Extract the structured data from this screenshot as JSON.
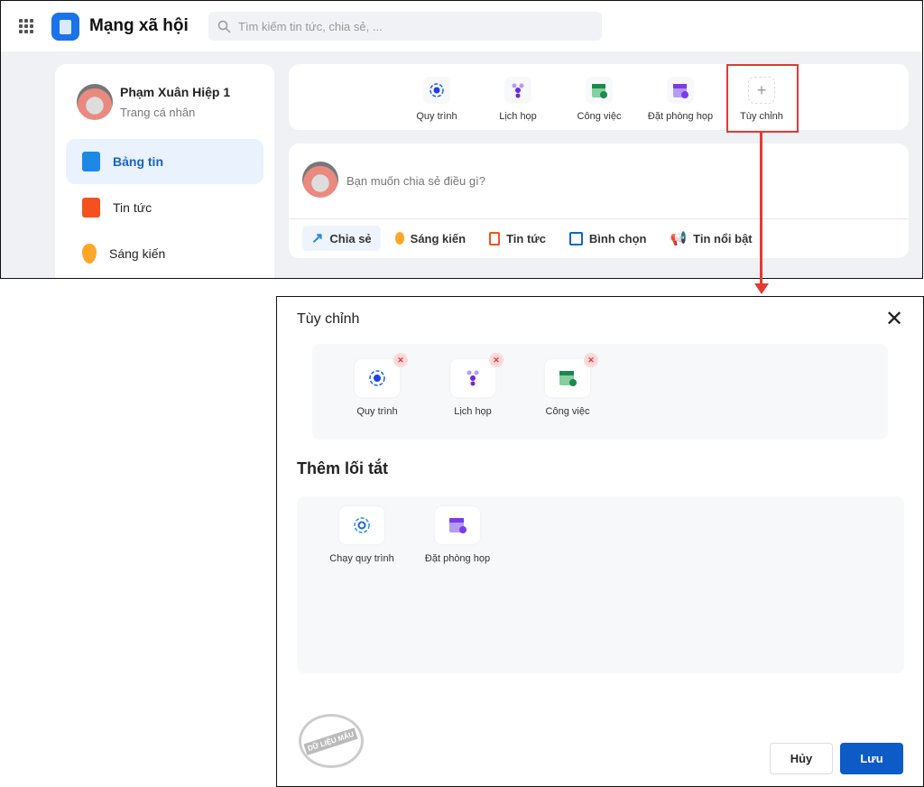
{
  "app": {
    "title": "Mạng xã hội",
    "search_placeholder": "Tìm kiếm tin tức, chia sẻ, ..."
  },
  "profile": {
    "name": "Phạm Xuân Hiệp 1",
    "subtitle": "Trang cá nhân"
  },
  "sidebar": {
    "items": [
      {
        "label": "Bảng tin",
        "active": true
      },
      {
        "label": "Tin tức"
      },
      {
        "label": "Sáng kiến"
      }
    ]
  },
  "shortcuts": [
    {
      "label": "Quy trình"
    },
    {
      "label": "Lịch họp"
    },
    {
      "label": "Công việc"
    },
    {
      "label": "Đặt phòng họp"
    },
    {
      "label": "Tùy chỉnh"
    }
  ],
  "composer": {
    "placeholder": "Bạn muốn chia sẻ điều gì?",
    "actions": [
      {
        "label": "Chia sẻ"
      },
      {
        "label": "Sáng kiến"
      },
      {
        "label": "Tin tức"
      },
      {
        "label": "Bình chọn"
      },
      {
        "label": "Tin nổi bật"
      }
    ]
  },
  "modal": {
    "title": "Tùy chỉnh",
    "current": [
      {
        "label": "Quy trình"
      },
      {
        "label": "Lịch họp"
      },
      {
        "label": "Công việc"
      }
    ],
    "add_title": "Thêm lối tắt",
    "available": [
      {
        "label": "Chạy quy trình"
      },
      {
        "label": "Đặt phòng họp"
      }
    ],
    "cancel": "Hủy",
    "save": "Lưu",
    "watermark": "DỮ LIỆU MẪU"
  },
  "colors": {
    "primary": "#0d5bc6",
    "highlight": "#e53935"
  }
}
